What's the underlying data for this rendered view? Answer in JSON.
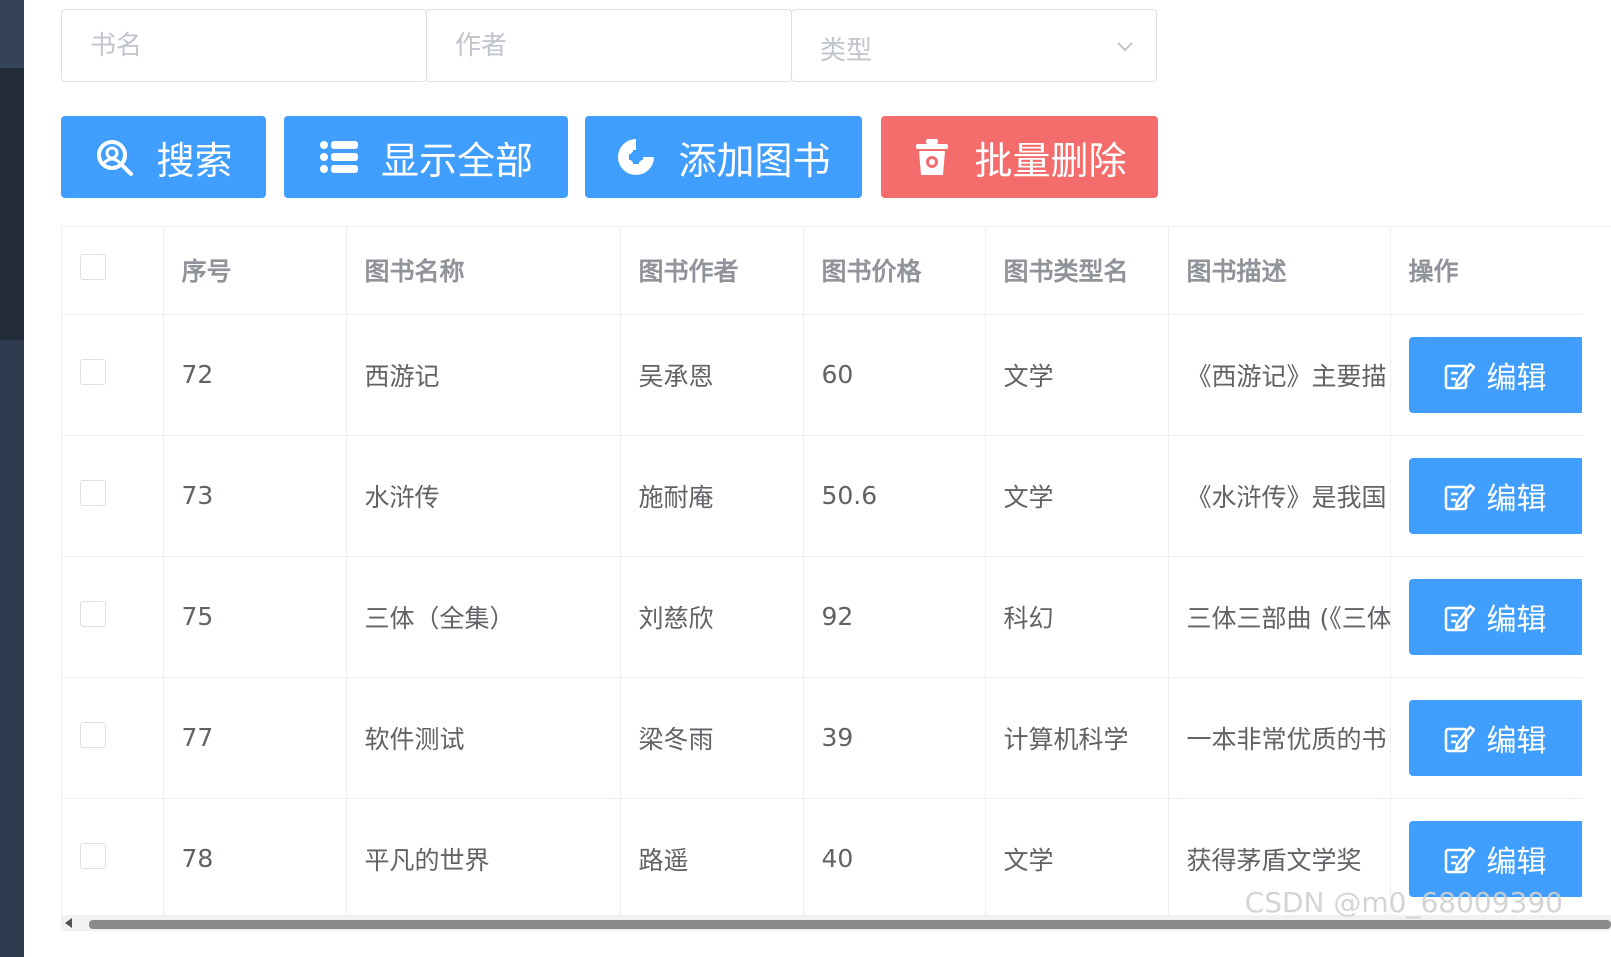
{
  "filters": {
    "name_placeholder": "书名",
    "author_placeholder": "作者",
    "type_placeholder": "类型"
  },
  "toolbar": {
    "search_label": "搜索",
    "show_all_label": "显示全部",
    "add_label": "添加图书",
    "batch_delete_label": "批量删除"
  },
  "table": {
    "headers": {
      "id": "序号",
      "name": "图书名称",
      "author": "图书作者",
      "price": "图书价格",
      "type": "图书类型名",
      "desc": "图书描述",
      "op": "操作"
    },
    "rows": [
      {
        "id": "72",
        "name": "西游记",
        "author": "吴承恩",
        "price": "60",
        "type": "文学",
        "desc": "《西游记》主要描",
        "edit": "编辑"
      },
      {
        "id": "73",
        "name": "水浒传",
        "author": "施耐庵",
        "price": "50.6",
        "type": "文学",
        "desc": "《水浒传》是我国",
        "edit": "编辑"
      },
      {
        "id": "75",
        "name": "三体（全集）",
        "author": "刘慈欣",
        "price": "92",
        "type": "科幻",
        "desc": "三体三部曲 (《三体",
        "edit": "编辑"
      },
      {
        "id": "77",
        "name": "软件测试",
        "author": "梁冬雨",
        "price": "39",
        "type": "计算机科学",
        "desc": "一本非常优质的书",
        "edit": "编辑"
      },
      {
        "id": "78",
        "name": "平凡的世界",
        "author": "路遥",
        "price": "40",
        "type": "文学",
        "desc": "获得茅盾文学奖",
        "edit": "编辑"
      }
    ]
  },
  "watermark": "CSDN @m0_68009390",
  "colors": {
    "primary": "#409eff",
    "danger": "#f56c6c",
    "sidebar": "#2e3a4e"
  }
}
